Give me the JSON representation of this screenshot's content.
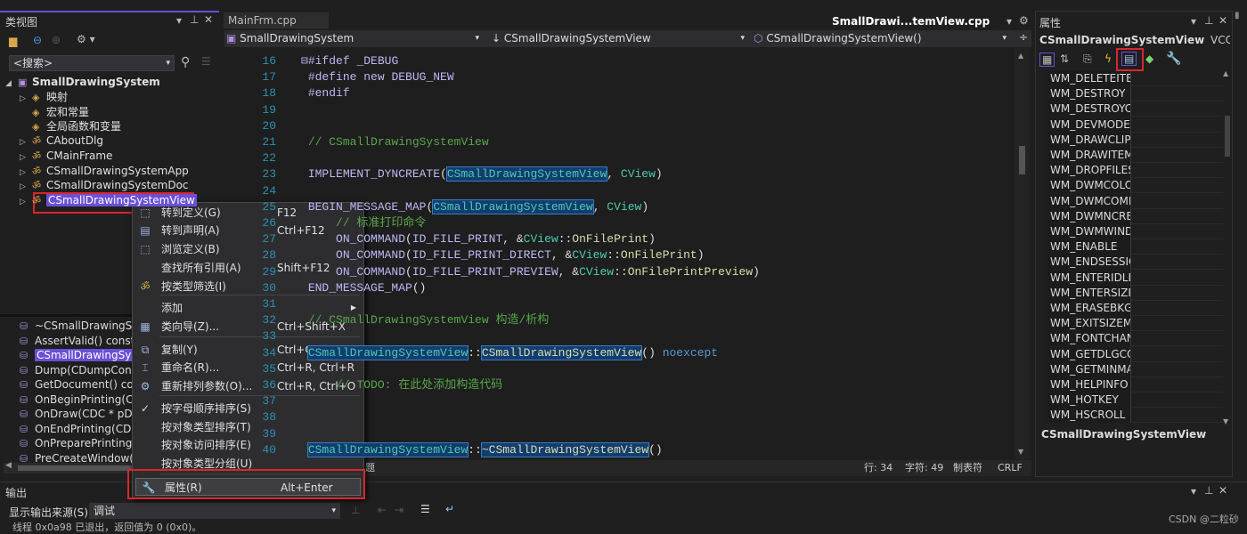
{
  "class_view": {
    "title": "类视图",
    "search_placeholder": "<搜索>",
    "tree": [
      {
        "label": "SmallDrawingSystem",
        "icon": "project-icon",
        "expander": "◢",
        "bold": true
      },
      {
        "label": "映射",
        "icon": "map-icon",
        "expander": "▷"
      },
      {
        "label": "宏和常量",
        "icon": "macro-icon",
        "expander": ""
      },
      {
        "label": "全局函数和变量",
        "icon": "global-icon",
        "expander": ""
      },
      {
        "label": "CAboutDlg",
        "icon": "class-icon",
        "expander": "▷"
      },
      {
        "label": "CMainFrame",
        "icon": "class-icon",
        "expander": "▷"
      },
      {
        "label": "CSmallDrawingSystemApp",
        "icon": "class-icon",
        "expander": "▷"
      },
      {
        "label": "CSmallDrawingSystemDoc",
        "icon": "class-icon",
        "expander": "▷"
      },
      {
        "label": "CSmallDrawingSystemView",
        "icon": "class-icon",
        "expander": "▷",
        "selected": true
      }
    ],
    "members": [
      "~CSmallDrawingSystemView()",
      "AssertValid() const",
      "CSmallDrawingSystemView()",
      "Dump(CDumpContext& dc) const",
      "GetDocument() const",
      "OnBeginPrinting(CDC* pDC, CPrintInfo* pInfo)",
      "OnDraw(CDC * pDC)",
      "OnEndPrinting(CDC* pDC, CPrintInfo* pInfo)",
      "OnPreparePrinting(CPrintInfo* pInfo)",
      "PreCreateWindow(CREATESTRUCT& cs)"
    ],
    "selected_member_index": 2
  },
  "editor": {
    "tabs": [
      {
        "label": "MainFrm.cpp",
        "active": false
      },
      {
        "label": "SmallDrawi...temView.cpp",
        "active": true
      }
    ],
    "nav": {
      "project": "SmallDrawingSystem",
      "class": "CSmallDrawingSystemView",
      "member": "CSmallDrawingSystemView()"
    },
    "lines": [
      {
        "n": "16",
        "html": "<span class='kw'>⊟#ifdef</span> <span class='kw'>_DEBUG</span>"
      },
      {
        "n": "17",
        "html": " <span class='kw'>#define</span> <span class='kw'>new DEBUG_NEW</span>"
      },
      {
        "n": "18",
        "html": " <span class='kw'>#endif</span>"
      },
      {
        "n": "19",
        "html": ""
      },
      {
        "n": "20",
        "html": ""
      },
      {
        "n": "21",
        "html": " <span class='cm'>// CSmallDrawingSystemView</span>"
      },
      {
        "n": "22",
        "html": ""
      },
      {
        "n": "23",
        "html": " <span class='kw'>IMPLEMENT_DYNCREATE</span>(<span class='ty hl'>CSmallDrawingSystemView</span>, <span class='ty'>CView</span>)"
      },
      {
        "n": "24",
        "html": ""
      },
      {
        "n": "25",
        "html": " <span class='kw'>BEGIN_MESSAGE_MAP</span>(<span class='ty hl'>CSmallDrawingSystemView</span>, <span class='ty'>CView</span>)"
      },
      {
        "n": "26",
        "html": "     <span class='cm'>// 标准打印命令</span>"
      },
      {
        "n": "27",
        "html": "     <span class='kw'>ON_COMMAND</span>(<span class='kw'>ID_FILE_PRINT</span>, &amp;<span class='ty'>CView</span>::<span class='fn'>OnFilePrint</span>)"
      },
      {
        "n": "28",
        "html": "     <span class='kw'>ON_COMMAND</span>(<span class='kw'>ID_FILE_PRINT_DIRECT</span>, &amp;<span class='ty'>CView</span>::<span class='fn'>OnFilePrint</span>)"
      },
      {
        "n": "29",
        "html": "     <span class='kw'>ON_COMMAND</span>(<span class='kw'>ID_FILE_PRINT_PREVIEW</span>, &amp;<span class='ty'>CView</span>::<span class='fn'>OnFilePrintPreview</span>)"
      },
      {
        "n": "30",
        "html": " <span class='kw'>END_MESSAGE_MAP</span>()"
      },
      {
        "n": "31",
        "html": ""
      },
      {
        "n": "32",
        "html": " <span class='cm'>// CSmallDrawingSystemView 构造/析构</span>"
      },
      {
        "n": "33",
        "html": ""
      },
      {
        "n": "34",
        "html": " <span class='ty hl'>CSmallDrawingSystemView</span>::<span class='fn hl'>CSmallDrawingSystemView</span>() <span class='bl'>noexcept</span>"
      },
      {
        "n": "35",
        "html": ""
      },
      {
        "n": "36",
        "html": "     <span class='cm'>// TODO: 在此处添加构造代码</span>"
      },
      {
        "n": "37",
        "html": ""
      },
      {
        "n": "38",
        "html": ""
      },
      {
        "n": "39",
        "html": ""
      },
      {
        "n": "40",
        "html": " <span class='ty hl'>CSmallDrawingSystemView</span>::<span class='fn hl'>~CSmallDrawingSystemView</span>()"
      }
    ],
    "status": {
      "issues": "未找到相关问题",
      "line": "行: 34",
      "char": "字符: 49",
      "tabs": "制表符",
      "eol": "CRLF"
    }
  },
  "context_menu": {
    "items": [
      {
        "label": "转到定义(G)",
        "shortcut": "F12",
        "icon": "go-to-definition-icon"
      },
      {
        "label": "转到声明(A)",
        "shortcut": "Ctrl+F12",
        "icon": "go-to-declaration-icon"
      },
      {
        "label": "浏览定义(B)",
        "shortcut": "",
        "icon": "browse-definition-icon"
      },
      {
        "label": "查找所有引用(A)",
        "shortcut": "Shift+F12",
        "icon": ""
      },
      {
        "label": "按类型筛选(I)",
        "shortcut": "",
        "icon": "filter-icon"
      },
      {
        "label": "添加",
        "shortcut": "",
        "icon": "",
        "submenu": true
      },
      {
        "label": "类向导(Z)...",
        "shortcut": "Ctrl+Shift+X",
        "icon": "class-wizard-icon"
      },
      {
        "label": "复制(Y)",
        "shortcut": "Ctrl+C",
        "icon": "copy-icon"
      },
      {
        "label": "重命名(R)...",
        "shortcut": "Ctrl+R, Ctrl+R",
        "icon": "rename-icon"
      },
      {
        "label": "重新排列参数(O)...",
        "shortcut": "Ctrl+R, Ctrl+O",
        "icon": "reorder-icon"
      },
      {
        "label": "按字母顺序排序(S)",
        "shortcut": "",
        "icon": "check-icon",
        "checked": true
      },
      {
        "label": "按对象类型排序(T)",
        "shortcut": "",
        "icon": ""
      },
      {
        "label": "按对象访问排序(E)",
        "shortcut": "",
        "icon": ""
      },
      {
        "label": "按对象类型分组(U)",
        "shortcut": "",
        "icon": ""
      },
      {
        "label": "属性(R)",
        "shortcut": "Alt+Enter",
        "icon": "wrench-icon",
        "highlighted": true
      }
    ]
  },
  "properties": {
    "title": "属性",
    "object": "CSmallDrawingSystemView",
    "object_type": "VCCod",
    "messages": [
      "WM_DELETEITEM",
      "WM_DESTROY",
      "WM_DESTROYCLIPBOARD",
      "WM_DEVMODECHANGE",
      "WM_DRAWCLIPBOARD",
      "WM_DRAWITEM",
      "WM_DROPFILES",
      "WM_DWMCOLORIZATIONCOLORCHANGED",
      "WM_DWMCOMPOSITIONCHANGED",
      "WM_DWMNCRENDERINGCHANGED",
      "WM_DWMWINDOWMAXIMIZEDCHANGE",
      "WM_ENABLE",
      "WM_ENDSESSION",
      "WM_ENTERIDLE",
      "WM_ENTERSIZEMOVE",
      "WM_ERASEBKGND",
      "WM_EXITSIZEMOVE",
      "WM_FONTCHANGE",
      "WM_GETDLGCODE",
      "WM_GETMINMAXINFO",
      "WM_HELPINFO",
      "WM_HOTKEY",
      "WM_HSCROLL"
    ],
    "description": "CSmallDrawingSystemView"
  },
  "output": {
    "title": "输出",
    "source_label": "显示输出来源(S):",
    "source_value": "调试",
    "text": "线程 0x0a98 已退出，返回值为 0 (0x0)。"
  },
  "watermark": "CSDN @二粒砂",
  "colors": {
    "accent": "#6b4fd6",
    "highlight_box": "#d9262b",
    "selection": "#113d6f"
  }
}
